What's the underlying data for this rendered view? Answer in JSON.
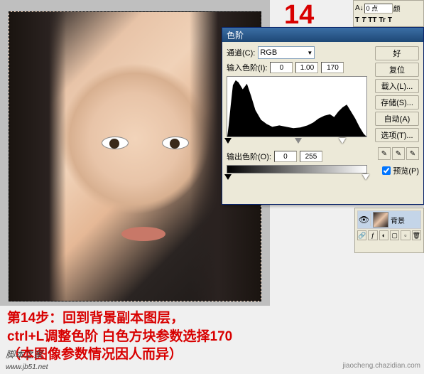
{
  "step_number": "14",
  "toolbar": {
    "field_value": "0 点",
    "field_label": "颜",
    "icons": [
      "T",
      "T",
      "TT",
      "Tr",
      "T"
    ]
  },
  "dialog": {
    "title": "色阶",
    "channel_label": "通道(C):",
    "channel_value": "RGB",
    "input_label": "输入色阶(I):",
    "input_shadow": "0",
    "input_mid": "1.00",
    "input_highlight": "170",
    "output_label": "输出色阶(O):",
    "output_shadow": "0",
    "output_highlight": "255",
    "buttons": {
      "ok": "好",
      "reset": "复位",
      "load": "载入(L)...",
      "save": "存储(S)...",
      "auto": "自动(A)",
      "options": "选项(T)..."
    },
    "preview_label": "预览(P)"
  },
  "layers": {
    "layer_name": "背景"
  },
  "instruction": {
    "line1": "第14步：回到背景副本图层，",
    "line2": "ctrl+L调整色阶  白色方块参数选择170",
    "line3": "（本图像参数情况因人而异）"
  },
  "watermark1": "脚本之家",
  "watermark1b": "www.jb51.net",
  "watermark2": "jiaocheng.chazidian.com"
}
